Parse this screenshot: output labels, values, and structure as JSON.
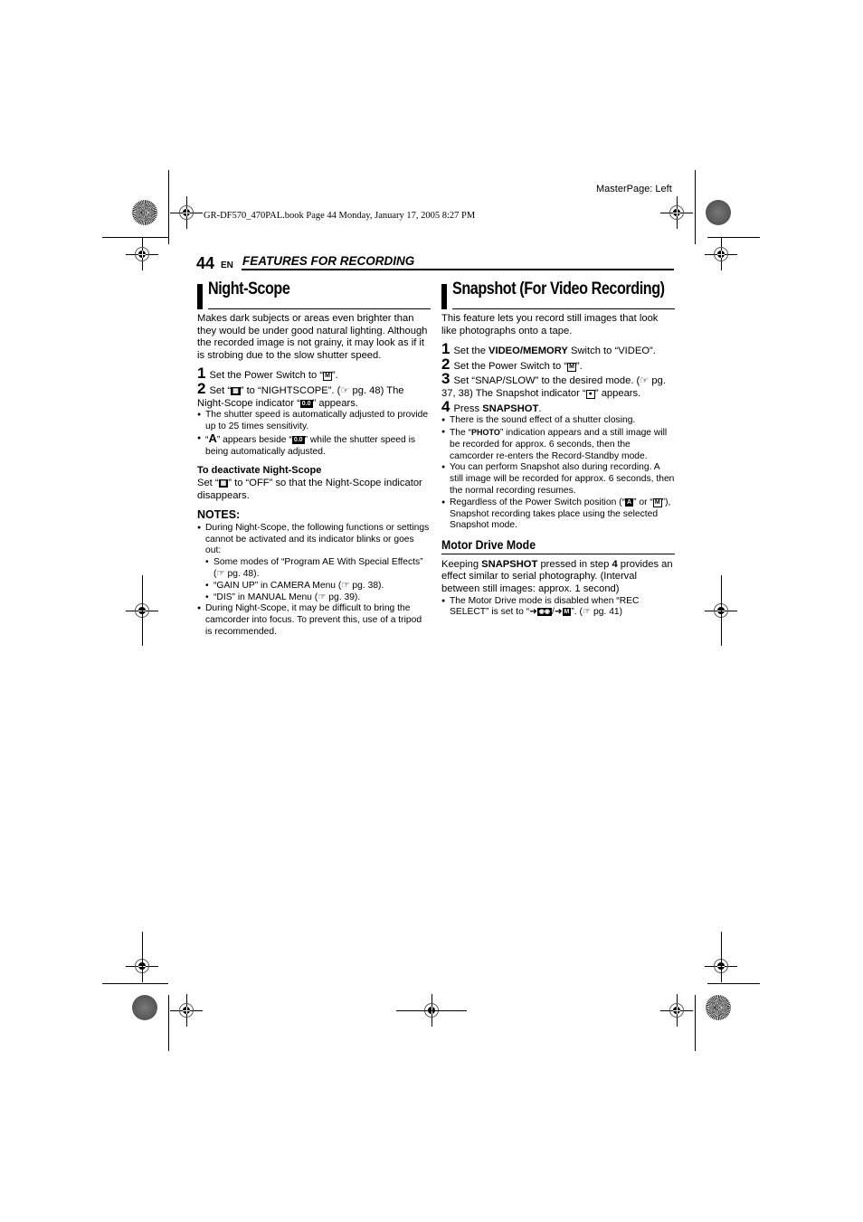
{
  "print_meta": {
    "masterpage": "MasterPage: Left",
    "book_line": "GR-DF570_470PAL.book  Page 44  Monday, January 17, 2005  8:27 PM"
  },
  "header": {
    "page_number": "44",
    "lang": "EN",
    "section": "FEATURES FOR RECORDING"
  },
  "night_scope": {
    "title": "Night-Scope",
    "intro": "Makes dark subjects or areas even brighter than they would be under good natural lighting. Although the recorded image is not grainy, it may look as if it is strobing due to the slow shutter speed.",
    "step1": {
      "num": "1",
      "pre": "Set the Power Switch to “",
      "icon": "M",
      "post": "”."
    },
    "step2": {
      "num": "2",
      "pre": "Set “",
      "icon": "menu",
      "mid": "” to “NIGHTSCOPE”. (",
      "ref": "☞",
      "ref_text": " pg. 48) The Night-Scope indicator “",
      "icon2": "0.0",
      "post": "” appears."
    },
    "bullets": [
      "The shutter speed is automatically adjusted to provide up to 25 times sensitivity.",
      {
        "pre": "“",
        "icon": "A",
        "mid": "” appears beside “",
        "icon2": "0.0",
        "post": "” while the shutter speed is being automatically adjusted."
      }
    ],
    "deactivate_title": "To deactivate Night-Scope",
    "deactivate_pre": "Set “",
    "deactivate_icon": "menu",
    "deactivate_post": "” to “OFF” so that the Night-Scope indicator disappears.",
    "notes_title": "NOTES:",
    "notes": {
      "n1": "During Night-Scope, the following functions or settings cannot be activated and its indicator blinks or goes out:",
      "sub1": "Some modes of “Program AE With Special Effects” (☞ pg. 48).",
      "sub2": "“GAIN UP” in CAMERA Menu (☞ pg. 38).",
      "sub3": "“DIS” in MANUAL Menu (☞ pg. 39).",
      "n2": "During Night-Scope, it may be difficult to bring the camcorder into focus. To prevent this, use of a tripod is recommended."
    }
  },
  "snapshot": {
    "title": "Snapshot (For Video Recording)",
    "intro": "This feature lets you record still images that look like photographs onto a tape.",
    "step1": {
      "num": "1",
      "pre": "Set the ",
      "bold": "VIDEO/MEMORY",
      "post": " Switch to “VIDEO”."
    },
    "step2": {
      "num": "2",
      "pre": "Set the Power Switch to “",
      "icon": "M",
      "post": "”."
    },
    "step3": {
      "num": "3",
      "pre": "Set “SNAP/SLOW” to the desired mode. (☞ pg. 37, 38) The Snapshot indicator “",
      "icon": "camera",
      "post": "” appears."
    },
    "step4": {
      "num": "4",
      "pre": "Press ",
      "bold": "SNAPSHOT",
      "post": "."
    },
    "bullets": {
      "b1": "There is the sound effect of a shutter closing.",
      "b2_pre": "The “",
      "b2_icon": "PHOTO",
      "b2_post": "” indication appears and a still image will be recorded for approx. 6 seconds, then the camcorder re-enters the Record-Standby mode.",
      "b3": "You can perform Snapshot also during recording. A still image will be recorded for approx. 6 seconds, then the normal recording resumes.",
      "b4_pre": "Regardless of the Power Switch position (“",
      "b4_icon1": "A",
      "b4_mid": "” or “",
      "b4_icon2": "M",
      "b4_post": "”), Snapshot recording takes place using the selected Snapshot mode."
    },
    "motor_drive": {
      "title": "Motor Drive Mode",
      "p_pre": "Keeping ",
      "p_bold1": "SNAPSHOT",
      "p_mid": " pressed in step ",
      "p_bold2": "4",
      "p_post": " provides an effect similar to serial photography. (Interval between still images: approx. 1 second)",
      "bullet_pre": "The Motor Drive mode is disabled when “REC SELECT” is set to “",
      "bullet_icon1": "tape",
      "bullet_sep": "/",
      "bullet_icon2": "M",
      "bullet_post": "”. (☞ pg. 41)"
    }
  }
}
